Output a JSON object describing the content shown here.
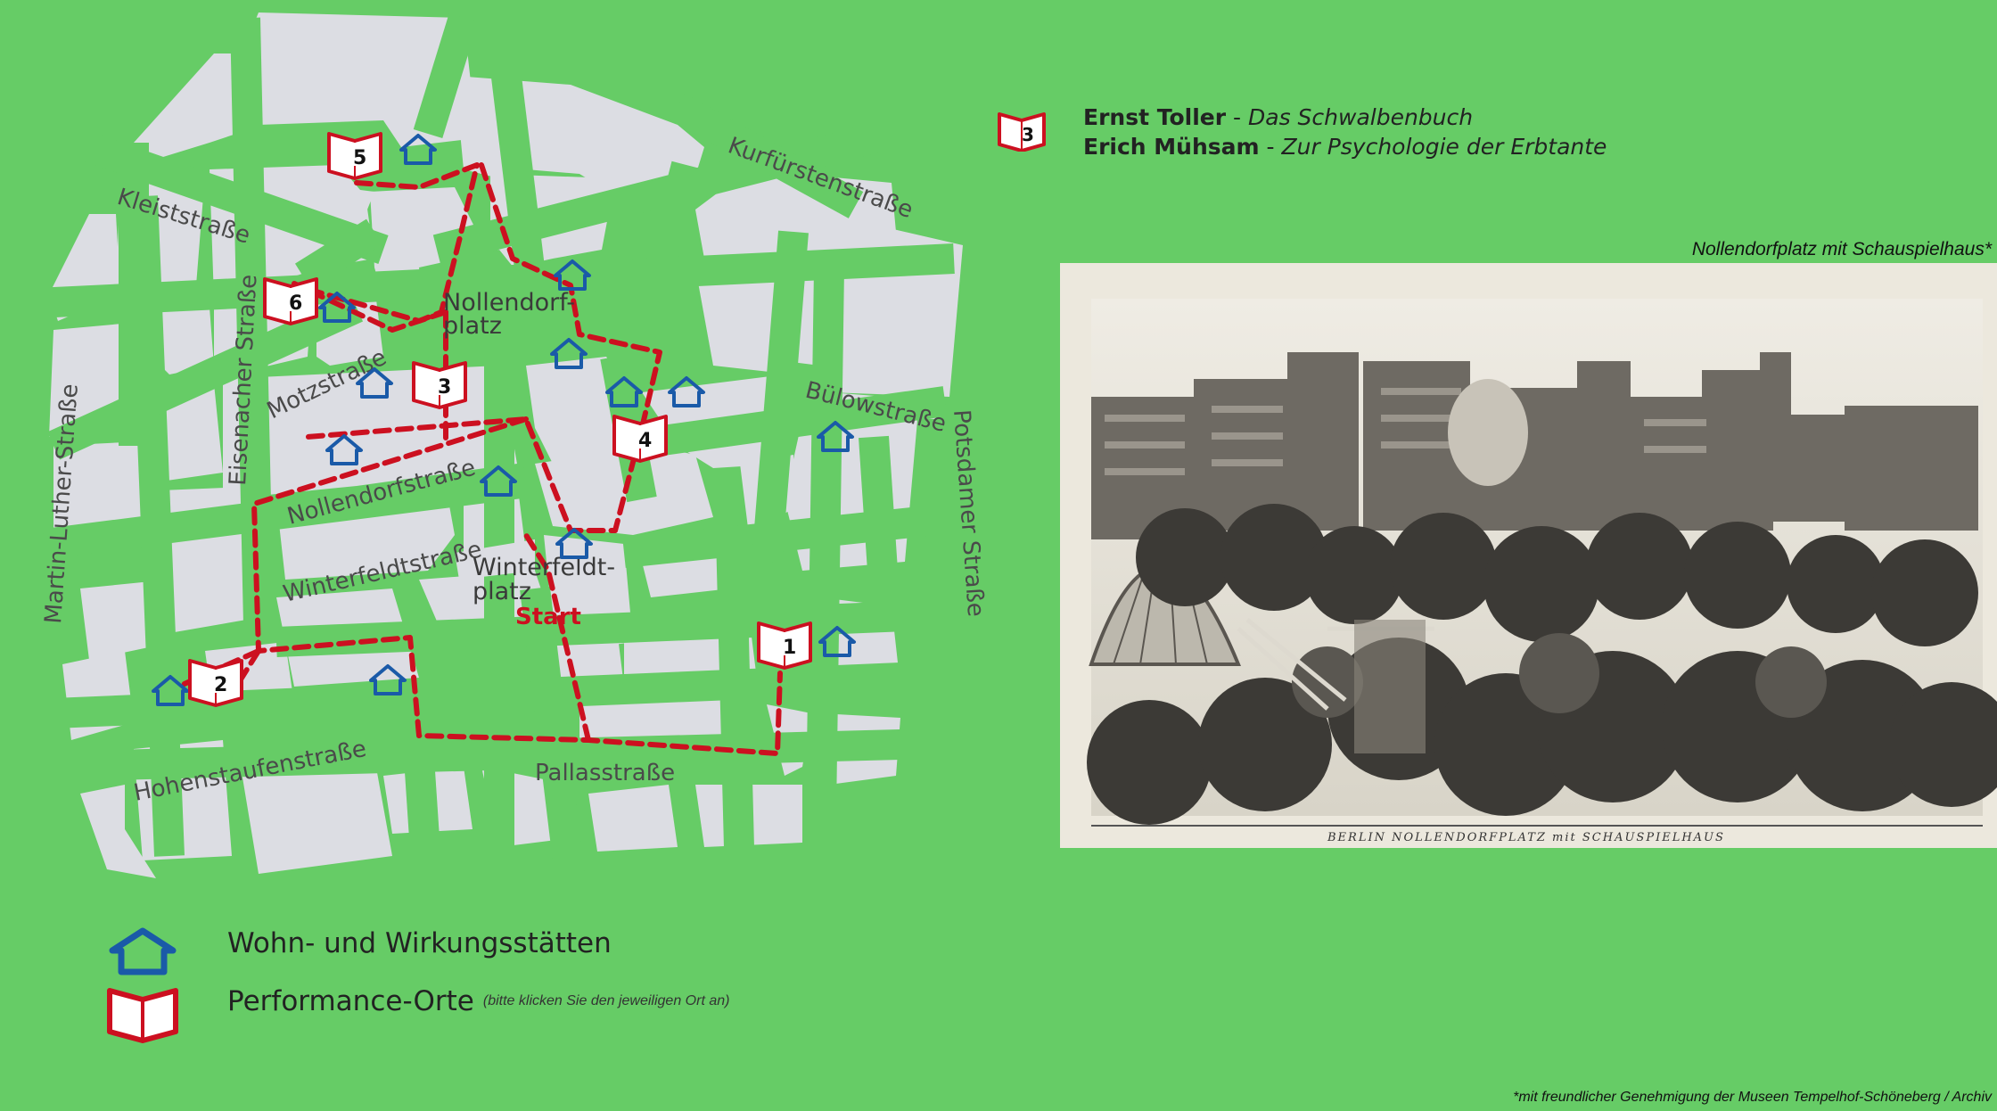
{
  "colors": {
    "background": "#66cc66",
    "block": "#dcdde3",
    "route": "#cc1020",
    "house": "#1a5aa8",
    "book": "#cc1020"
  },
  "streets": {
    "kleist": "Kleiststraße",
    "kurfuersten": "Kurfürstenstraße",
    "eisenacher": "Eisenacher Straße",
    "motz": "Motzstraße",
    "martin_luther": "Martin-Luther-Straße",
    "buelow": "Bülowstraße",
    "potsdamer": "Potsdamer Straße",
    "nollendorf": "Nollendorfstraße",
    "winterfeldt": "Winterfeldtstraße",
    "hohenstaufen": "Hohenstaufenstraße",
    "pallas": "Pallasstraße"
  },
  "places": {
    "nollendorfplatz_1": "Nollendorf-",
    "nollendorfplatz_2": "platz",
    "winterfeldtplatz_1": "Winterfeldt-",
    "winterfeldtplatz_2": "platz",
    "start": "Start"
  },
  "markers": {
    "books": [
      {
        "number": "1"
      },
      {
        "number": "2"
      },
      {
        "number": "3"
      },
      {
        "number": "4"
      },
      {
        "number": "5"
      },
      {
        "number": "6"
      }
    ],
    "house_count": 14
  },
  "legend": {
    "houses": "Wohn- und Wirkungsstätten",
    "performance": "Performance-Orte",
    "performance_note": "(bitte klicken Sie den jeweiligen Ort an)"
  },
  "info": {
    "marker_number": "3",
    "author1": "Ernst Toller",
    "work1": "Das Schwalbenbuch",
    "author2": "Erich Mühsam",
    "work2": "Zur Psychologie der Erbtante",
    "separator": " - "
  },
  "photo": {
    "caption": "Nollendorfplatz mit Schauspielhaus*",
    "label": "BERLIN NOLLENDORFPLATZ mit SCHAUSPIELHAUS"
  },
  "footer": "*mit freundlicher Genehmigung der Museen Tempelhof-Schöneberg / Archiv"
}
